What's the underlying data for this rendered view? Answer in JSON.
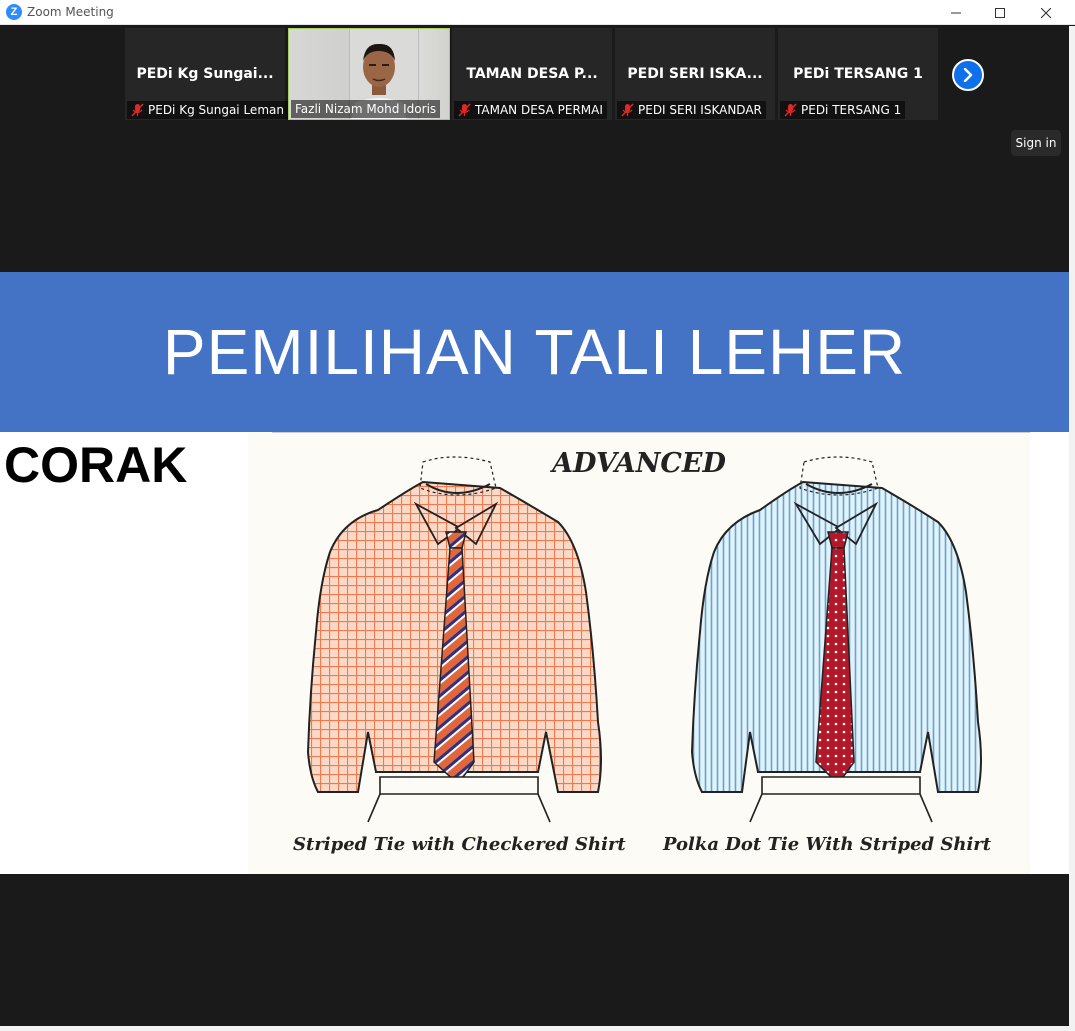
{
  "window": {
    "title": "Zoom Meeting",
    "icon_letter": "Z"
  },
  "participants": [
    {
      "display_name": "PEDi  Kg  Sungai...",
      "label": "PEDi Kg Sungai Leman",
      "muted": true,
      "video": false
    },
    {
      "display_name": "",
      "label": "Fazli Nizam Mohd Idoris",
      "muted": false,
      "video": true
    },
    {
      "display_name": "TAMAN DESA P...",
      "label": "TAMAN DESA PERMAI",
      "muted": true,
      "video": false
    },
    {
      "display_name": "PEDI  SERI  ISKA...",
      "label": "PEDI SERI ISKANDAR",
      "muted": true,
      "video": false
    },
    {
      "display_name": "PEDi TERSANG 1",
      "label": "PEDi TERSANG 1",
      "muted": true,
      "video": false
    }
  ],
  "controls": {
    "next_icon": "chevron-right-icon",
    "sign_in": "Sign in"
  },
  "slide": {
    "title": "PEMILIHAN TALI LEHER",
    "side_heading": "CORAK",
    "illustration": {
      "heading": "ADVANCED",
      "caption_left": "Striped Tie with Checkered Shirt",
      "caption_right": "Polka Dot Tie With Striped Shirt"
    }
  },
  "colors": {
    "slide_header": "#4472c4",
    "zoom_blue": "#0e71eb",
    "mute_red": "#e02828",
    "shirt_orange": "#f07a50",
    "shirt_blue": "#8fc3e0",
    "tie_red": "#b3182a"
  }
}
